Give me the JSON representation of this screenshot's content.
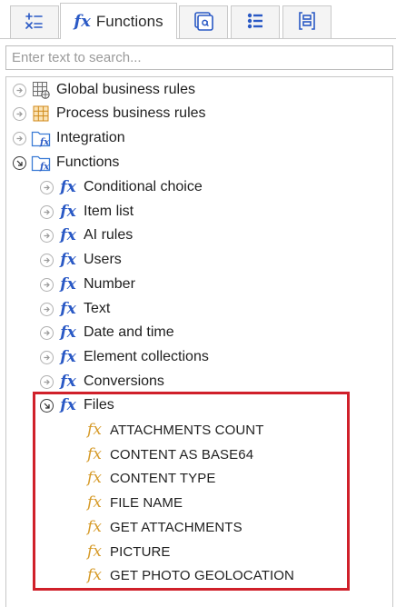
{
  "tabs": {
    "functions_label": "Functions"
  },
  "search": {
    "placeholder": "Enter text to search..."
  },
  "tree": {
    "global_business_rules": "Global business rules",
    "process_business_rules": "Process business rules",
    "integration": "Integration",
    "functions": "Functions",
    "function_groups": [
      "Conditional choice",
      "Item list",
      "AI rules",
      "Users",
      "Number",
      "Text",
      "Date and time",
      "Element collections",
      "Conversions"
    ],
    "files": "Files",
    "file_functions": [
      "ATTACHMENTS COUNT",
      "CONTENT AS BASE64",
      "CONTENT TYPE",
      "FILE NAME",
      "GET ATTACHMENTS",
      "PICTURE",
      "GET PHOTO GEOLOCATION"
    ]
  },
  "colors": {
    "fx_blue": "#2a59c5",
    "fx_orange": "#d69a28",
    "highlight_red": "#d0202a"
  }
}
